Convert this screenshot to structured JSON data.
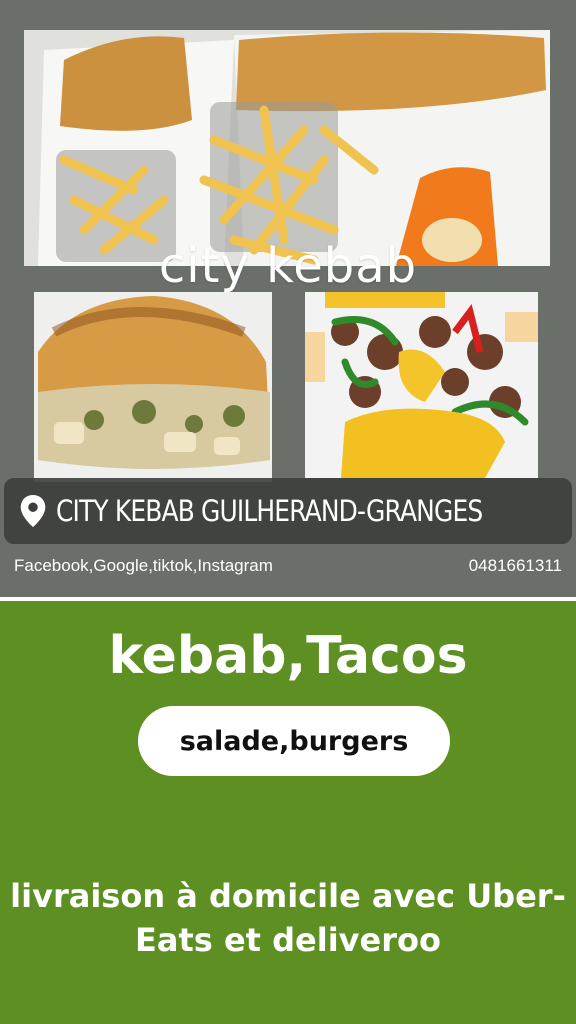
{
  "brand": {
    "name": "city kebab"
  },
  "location": {
    "icon": "location-pin-icon",
    "name": "CITY KEBAB GUILHERAND-GRANGES"
  },
  "contact": {
    "socials": "Facebook,Google,tiktok,Instagram",
    "phone": "0481661311"
  },
  "menu": {
    "headline": "kebab,Tacos",
    "secondary": "salade,burgers"
  },
  "delivery": {
    "line1": "livraison à domicile avec Uber-",
    "line2": "Eats et deliveroo"
  },
  "colors": {
    "background_green": "#5d8f23",
    "top_gray": "#6a6f6a",
    "text": "#ffffff"
  }
}
